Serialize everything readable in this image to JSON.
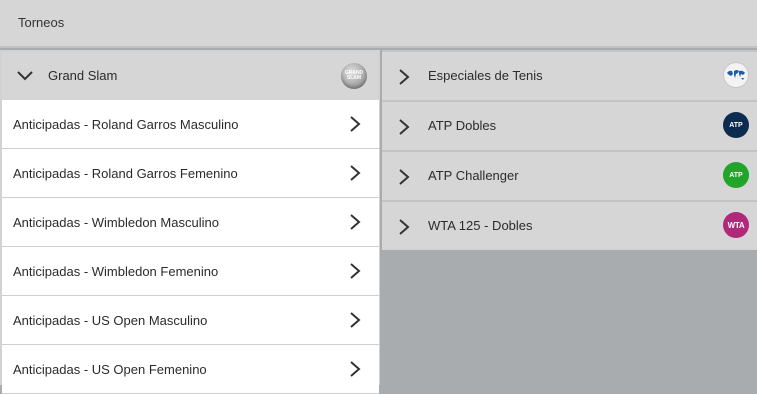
{
  "header": {
    "title": "Torneos"
  },
  "left": {
    "group_title": "Grand Slam",
    "group_logo_text": [
      "GRAND",
      "SLAM"
    ],
    "items": [
      {
        "label": "Anticipadas - Roland Garros Masculino"
      },
      {
        "label": "Anticipadas - Roland Garros Femenino"
      },
      {
        "label": "Anticipadas - Wimbledon Masculino"
      },
      {
        "label": "Anticipadas - Wimbledon Femenino"
      },
      {
        "label": "Anticipadas - US Open Masculino"
      },
      {
        "label": "Anticipadas - US Open Femenino"
      }
    ]
  },
  "right": {
    "items": [
      {
        "label": "Especiales de Tenis",
        "logo": "world-map-icon"
      },
      {
        "label": "ATP Dobles",
        "logo": "atp-logo-icon",
        "logo_text": "ATP"
      },
      {
        "label": "ATP Challenger",
        "logo": "atp-challenger-logo-icon",
        "logo_text": "ATP"
      },
      {
        "label": "WTA 125 - Dobles",
        "logo": "wta-logo-icon",
        "logo_text": "WTA"
      }
    ]
  },
  "colors": {
    "background": "#a8acaf",
    "panel": "#d6d6d6",
    "row": "#ffffff",
    "atp_dobles": "#0d2b4f",
    "atp_challenger": "#22a32a",
    "wta": "#b0287a"
  }
}
